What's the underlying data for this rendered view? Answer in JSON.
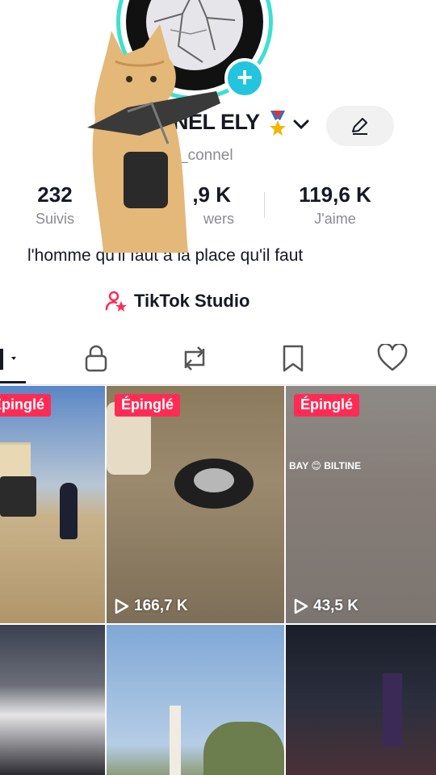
{
  "profile": {
    "username": "CONNEL ELY",
    "username_visible": "NEL ELY",
    "handle": "_connel",
    "bio": "l'homme qu'il faut à la place qu'il faut",
    "medal_icon": "medal-icon"
  },
  "stats": {
    "following": {
      "value": "232",
      "label": "Suivis"
    },
    "followers": {
      "value": ",9 K",
      "label": "wers"
    },
    "likes": {
      "value": "119,6 K",
      "label": "J'aime"
    }
  },
  "studio": {
    "label": "TikTok Studio"
  },
  "tabs": [
    "videos-grid-icon",
    "lock-icon",
    "repost-icon",
    "bookmark-icon",
    "heart-icon"
  ],
  "colors": {
    "accent": "#fe2c55",
    "ring": "#3fe0d0",
    "plus": "#23c4de"
  },
  "videos": [
    {
      "pinned_label": "Épinglé",
      "views": ""
    },
    {
      "pinned_label": "Épinglé",
      "views": "166,7 K"
    },
    {
      "pinned_label": "Épinglé",
      "views": "43,5 K",
      "overlay": "BAY 😊 BILTINE"
    },
    {
      "pinned_label": "",
      "views": ""
    },
    {
      "pinned_label": "",
      "views": ""
    },
    {
      "pinned_label": "",
      "views": ""
    }
  ]
}
